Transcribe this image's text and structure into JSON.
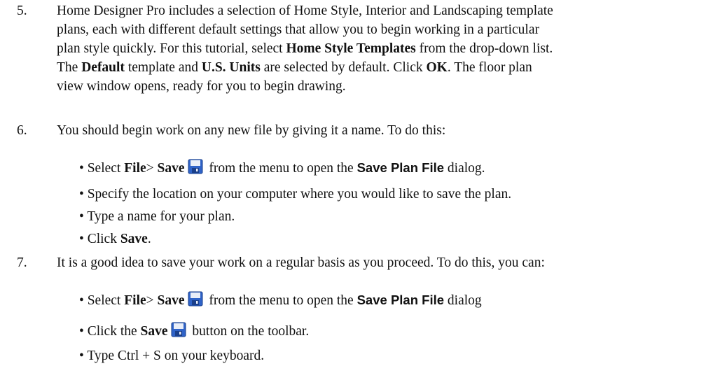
{
  "steps": [
    {
      "number": "5.",
      "lines": [
        [
          {
            "t": "Home Designer Pro includes a selection of Home Style, Interior and Landscaping template"
          }
        ],
        [
          {
            "t": "plans, each with different default settings that allow you to begin working in a particular"
          }
        ],
        [
          {
            "t": "plan style quickly. For this tutorial, select "
          },
          {
            "t": "Home Style Templates",
            "b": true
          },
          {
            "t": " from the drop-down list."
          }
        ],
        [
          {
            "t": "The "
          },
          {
            "t": "Default",
            "b": true
          },
          {
            "t": " template and "
          },
          {
            "t": "U.S. Units",
            "b": true
          },
          {
            "t": " are selected by default. Click "
          },
          {
            "t": "OK",
            "b": true
          },
          {
            "t": ". The floor plan"
          }
        ],
        [
          {
            "t": "view window opens, ready for you to begin drawing."
          }
        ]
      ]
    },
    {
      "number": "6.",
      "lines": [
        [
          {
            "t": "You should begin work on any new file by giving it a name. To do this:"
          }
        ]
      ],
      "bullets": [
        [
          {
            "t": "• Select "
          },
          {
            "t": "File",
            "b": true
          },
          {
            "t": "> "
          },
          {
            "t": "Save",
            "b": true
          },
          {
            "t": " ",
            "icon": "save-icon"
          },
          {
            "t": " from the menu to open the "
          },
          {
            "t": "Save Plan File",
            "sans": true
          },
          {
            "t": " dialog."
          }
        ],
        [
          {
            "t": "• Specify the location on your computer where you would like to save the plan."
          }
        ],
        [
          {
            "t": "• Type a name for your plan."
          }
        ],
        [
          {
            "t": "• Click "
          },
          {
            "t": "Save",
            "b": true
          },
          {
            "t": "."
          }
        ]
      ]
    },
    {
      "number": "7.",
      "lines": [
        [
          {
            "t": "It is a good idea to save your work on a regular basis as you proceed. To do this, you can:"
          }
        ]
      ],
      "bullets": [
        [
          {
            "t": "• Select "
          },
          {
            "t": "File",
            "b": true
          },
          {
            "t": "> "
          },
          {
            "t": "Save",
            "b": true
          },
          {
            "t": " ",
            "icon": "save-icon"
          },
          {
            "t": " from the menu to open the "
          },
          {
            "t": "Save Plan File",
            "sans": true
          },
          {
            "t": " dialog"
          }
        ],
        [
          {
            "t": "• Click the "
          },
          {
            "t": "Save",
            "b": true
          },
          {
            "t": " ",
            "icon": "save-icon"
          },
          {
            "t": " button on the toolbar."
          }
        ],
        [
          {
            "t": "• Type Ctrl + S on your keyboard."
          }
        ]
      ]
    }
  ],
  "icon_colors": {
    "save_icon_blue": "#2f63c8",
    "save_icon_dark": "#1a3f8a",
    "save_icon_label": "#e9eef8"
  }
}
